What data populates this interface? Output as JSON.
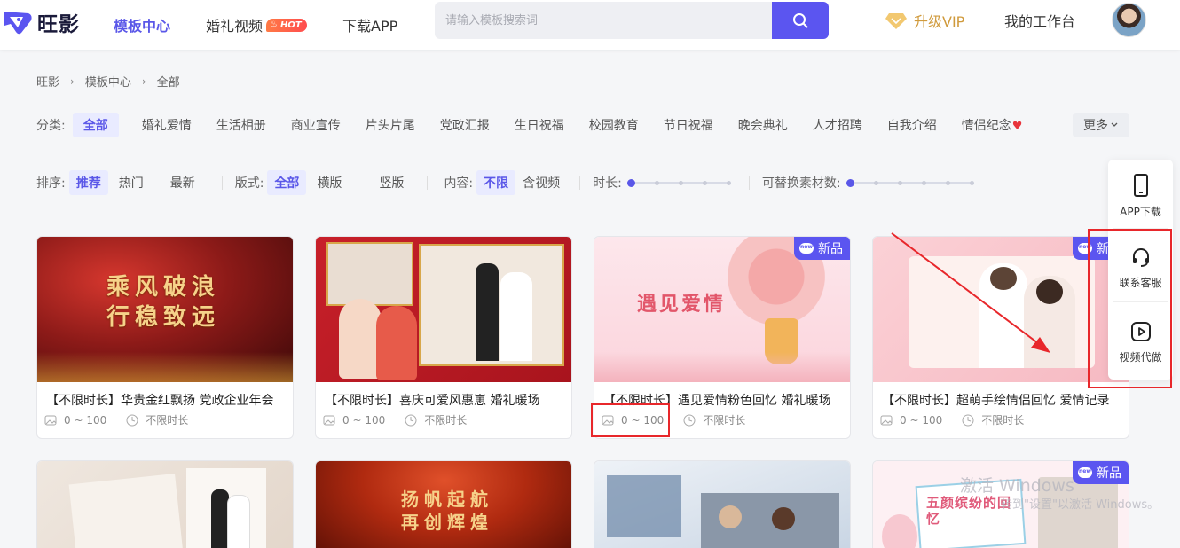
{
  "header": {
    "logo_text": "旺影",
    "nav": [
      {
        "label": "模板中心"
      },
      {
        "label": "婚礼视频",
        "badge": "HOT"
      },
      {
        "label": "下载APP"
      }
    ],
    "search": {
      "placeholder": "请输入模板搜索词"
    },
    "vip_label": "升级VIP",
    "workbench_label": "我的工作台"
  },
  "breadcrumb": [
    "旺影",
    "模板中心",
    "全部"
  ],
  "categories": {
    "label": "分类:",
    "items": [
      "全部",
      "婚礼爱情",
      "生活相册",
      "商业宣传",
      "片头片尾",
      "党政汇报",
      "生日祝福",
      "校园教育",
      "节日祝福",
      "晚会典礼",
      "人才招聘",
      "自我介绍",
      "情侣纪念"
    ],
    "heart": "♥",
    "more_label": "更多"
  },
  "filters": {
    "sort_label": "排序:",
    "sort_options": [
      "推荐",
      "热门",
      "最新"
    ],
    "layout_label": "版式:",
    "layout_options": [
      "全部",
      "横版",
      "竖版"
    ],
    "content_label": "内容:",
    "content_options": [
      "不限",
      "含视频"
    ],
    "duration_label": "时长:",
    "materials_label": "可替换素材数:"
  },
  "cards": [
    {
      "title": "【不限时长】华贵金红飘扬 党政企业年会",
      "range": "0 ~ 100",
      "duration": "不限时长",
      "overlay": "乘风破浪\n行稳致远",
      "is_new": false
    },
    {
      "title": "【不限时长】喜庆可爱风惠崽 婚礼暖场",
      "range": "0 ~ 100",
      "duration": "不限时长",
      "is_new": false
    },
    {
      "title": "【不限时长】遇见爱情粉色回忆 婚礼暖场",
      "range": "0 ~ 100",
      "duration": "不限时长",
      "overlay": "遇见爱情",
      "is_new": true
    },
    {
      "title": "【不限时长】超萌手绘情侣回忆 爱情记录",
      "range": "0 ~ 100",
      "duration": "不限时长",
      "is_new": true
    }
  ],
  "cards_row2": [
    {
      "is_new": false
    },
    {
      "overlay": "扬帆起航\n再创辉煌",
      "is_new": false
    },
    {
      "is_new": false
    },
    {
      "overlay": "五颜缤纷的回忆",
      "is_new": true
    }
  ],
  "new_badge": "新品",
  "side_panel": {
    "items": [
      "APP下载",
      "联系客服",
      "视频代做"
    ]
  },
  "watermark": {
    "line1": "激活 Windows",
    "line2": "转到\"设置\"以激活 Windows。"
  },
  "colors": {
    "accent": "#5b55f0",
    "vip": "#d09a3c",
    "annotation": "#e8272b"
  }
}
